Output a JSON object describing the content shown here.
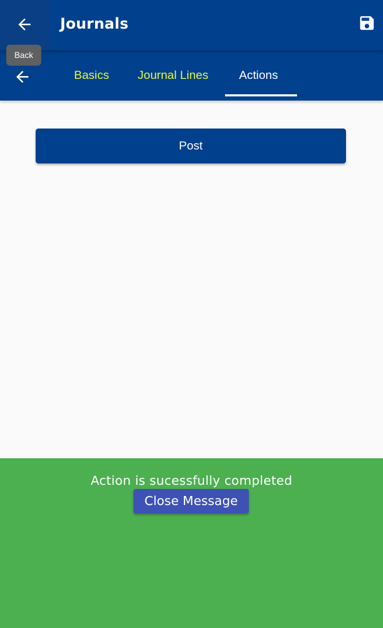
{
  "appbar": {
    "title": "Journals",
    "back_tooltip": "Back",
    "back_icon": "arrow-left-icon",
    "save_icon": "floppy-disk-icon"
  },
  "tabs": [
    {
      "label": "Basics",
      "active": false
    },
    {
      "label": "Journal Lines",
      "active": false
    },
    {
      "label": "Actions",
      "active": true
    }
  ],
  "actions": {
    "post_label": "Post"
  },
  "toast": {
    "message": "Action is sucessfully completed",
    "close_label": "Close Message"
  },
  "colors": {
    "primary": "#01408c",
    "tab_inactive_text": "#e6f54a",
    "toast_bg": "#4caf50",
    "close_button": "#3e51b5",
    "tooltip_bg": "#5f6061"
  }
}
